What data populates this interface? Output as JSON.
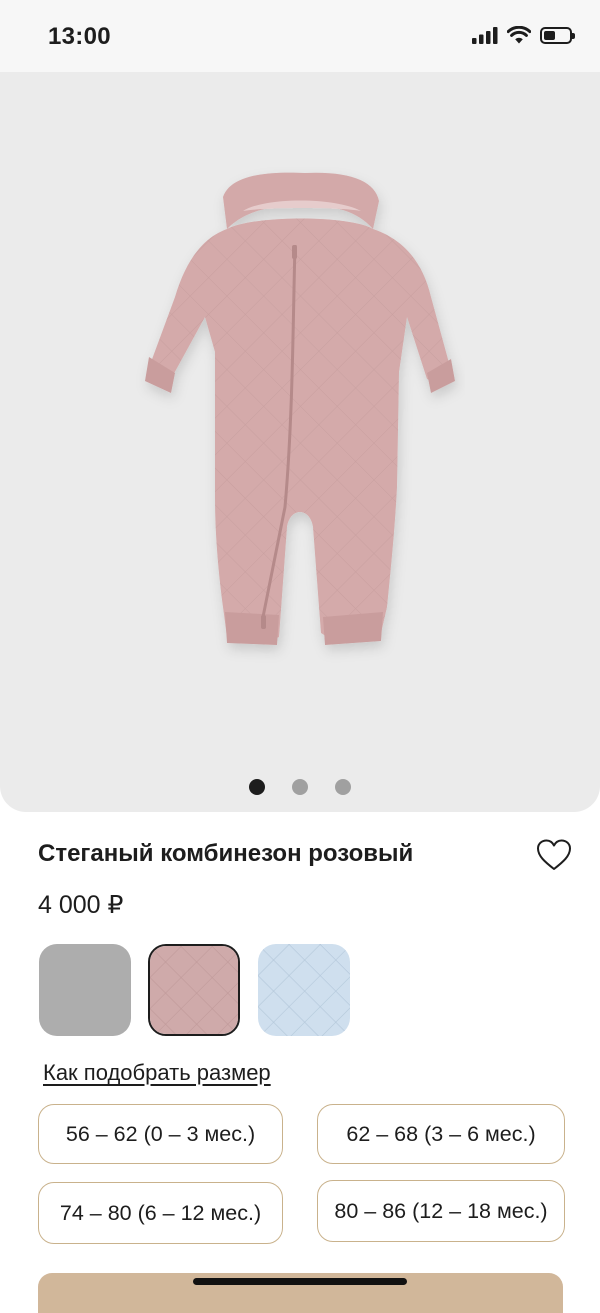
{
  "status_bar": {
    "time": "13:00",
    "battery_level": 0.45
  },
  "gallery": {
    "image": "pink-quilted-hooded-jumpsuit",
    "dots_total": 3,
    "active_index": 0
  },
  "product": {
    "title": "Стеганый комбинезон розовый",
    "price": "4 000 ₽",
    "favorite_icon": "heart-outline-icon"
  },
  "colors": [
    {
      "name": "grey",
      "hex": "#a9a9a9",
      "selected": false
    },
    {
      "name": "pink",
      "hex": "#cfaaaa",
      "selected": true
    },
    {
      "name": "light-blue",
      "hex": "#cfdfee",
      "selected": false
    }
  ],
  "size_guide_label": "Как подобрать размер",
  "sizes": [
    {
      "label": "56 – 62 (0 – 3 мес.)"
    },
    {
      "label": "62 – 68 (3 – 6 мес.)"
    },
    {
      "label": "74 – 80 (6 – 12 мес.)"
    },
    {
      "label": "80 – 86 (12 – 18 мес.)"
    }
  ],
  "theme": {
    "accent": "#d1b79a",
    "size_border": "#c9b28c",
    "text": "#1d1d1d",
    "gallery_bg": "#ebebeb"
  }
}
